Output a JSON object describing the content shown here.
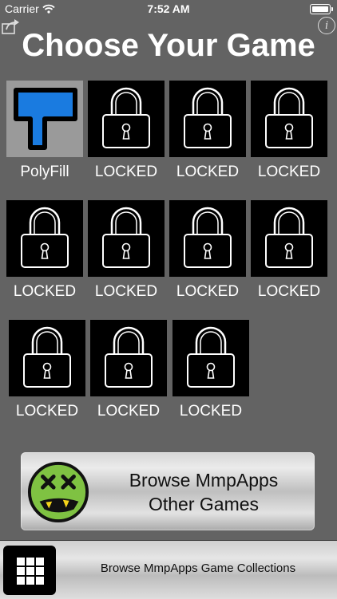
{
  "status_bar": {
    "carrier": "Carrier",
    "time": "7:52 AM"
  },
  "header": {
    "title": "Choose Your Game",
    "info_glyph": "i"
  },
  "games": [
    {
      "label": "PolyFill",
      "locked": false,
      "icon": "polyfill-icon"
    },
    {
      "label": "LOCKED",
      "locked": true,
      "icon": "padlock-icon"
    },
    {
      "label": "LOCKED",
      "locked": true,
      "icon": "padlock-icon"
    },
    {
      "label": "LOCKED",
      "locked": true,
      "icon": "padlock-icon"
    },
    {
      "label": "LOCKED",
      "locked": true,
      "icon": "padlock-icon"
    },
    {
      "label": "LOCKED",
      "locked": true,
      "icon": "padlock-icon"
    },
    {
      "label": "LOCKED",
      "locked": true,
      "icon": "padlock-icon"
    },
    {
      "label": "LOCKED",
      "locked": true,
      "icon": "padlock-icon"
    },
    {
      "label": "LOCKED",
      "locked": true,
      "icon": "padlock-icon"
    },
    {
      "label": "LOCKED",
      "locked": true,
      "icon": "padlock-icon"
    },
    {
      "label": "LOCKED",
      "locked": true,
      "icon": "padlock-icon"
    }
  ],
  "browse_button": {
    "line1": "Browse MmpApps",
    "line2": "Other Games",
    "icon": "dizzy-face-icon"
  },
  "bottom_bar": {
    "label": "Browse MmpApps Game Collections",
    "icon": "grid-icon"
  },
  "colors": {
    "background": "#636363",
    "polyfill_blue": "#1a7be0",
    "tile_locked": "#000000"
  }
}
